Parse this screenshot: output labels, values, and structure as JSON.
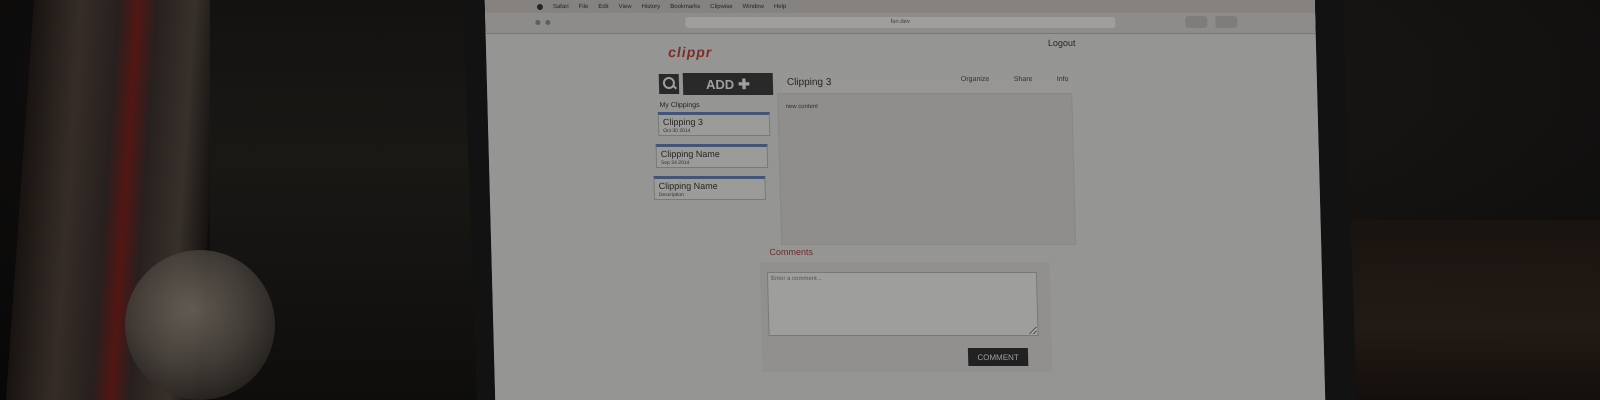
{
  "app": {
    "logo": "clippr",
    "logout": "Logout"
  },
  "browser": {
    "menu_items": [
      "Safari",
      "File",
      "Edit",
      "View",
      "History",
      "Bookmarks",
      "Clipwise",
      "Window",
      "Help"
    ],
    "url": "fsn.dev"
  },
  "toolbar": {
    "add_label": "ADD",
    "add_icon": "plus-icon",
    "search_icon": "search-icon"
  },
  "sidebar": {
    "heading": "My Clippings",
    "items": [
      {
        "name": "Clipping 3",
        "date": "Oct 30 2014"
      },
      {
        "name": "Clipping Name",
        "date": "Sep 24 2014"
      },
      {
        "name": "Clipping Name",
        "date": "Description"
      }
    ]
  },
  "main": {
    "title": "Clipping 3",
    "tabs": [
      "Organize",
      "Share",
      "Info"
    ],
    "content": "new content"
  },
  "comments": {
    "label": "Comments",
    "placeholder": "Enter a comment...",
    "button": "COMMENT"
  }
}
